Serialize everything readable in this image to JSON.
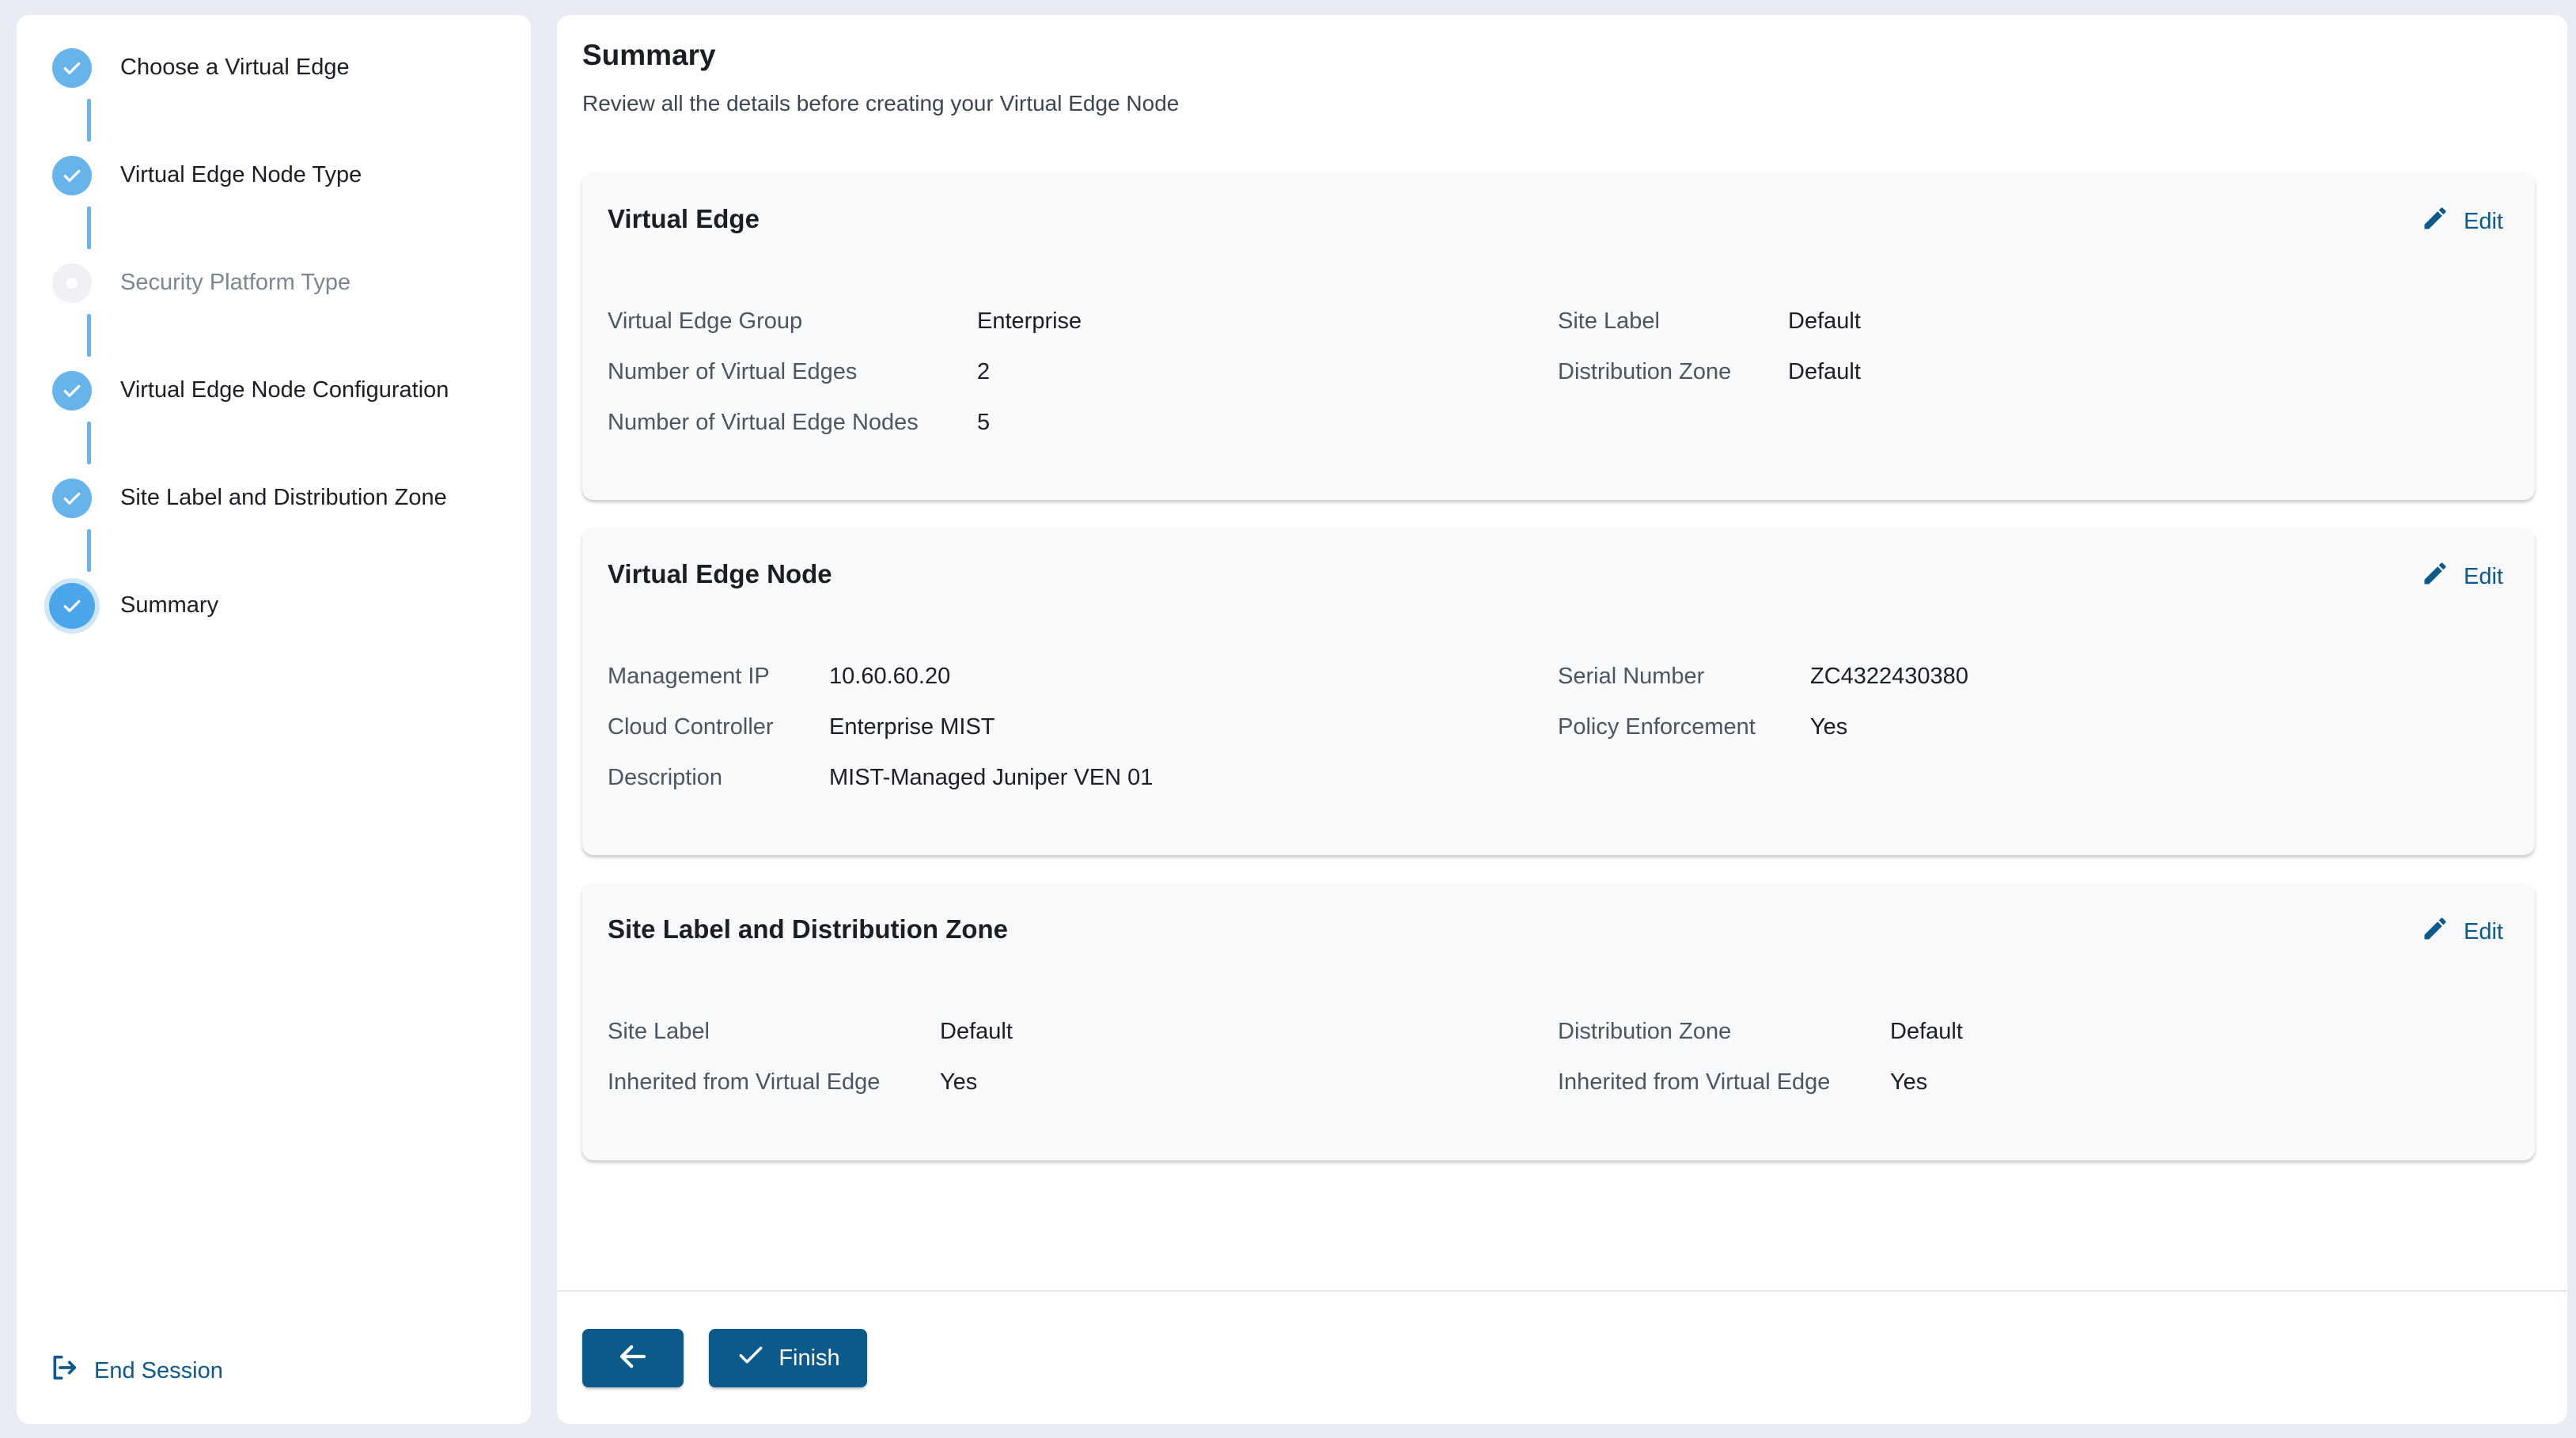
{
  "sidebar": {
    "steps": [
      {
        "label": "Choose a Virtual Edge",
        "state": "complete"
      },
      {
        "label": "Virtual Edge Node Type",
        "state": "complete"
      },
      {
        "label": "Security Platform Type",
        "state": "inactive"
      },
      {
        "label": "Virtual Edge Node Configuration",
        "state": "complete"
      },
      {
        "label": "Site Label and Distribution Zone",
        "state": "complete"
      },
      {
        "label": "Summary",
        "state": "active"
      }
    ],
    "end_session_label": "End Session"
  },
  "main": {
    "title": "Summary",
    "subtitle": "Review all the details before creating your Virtual Edge Node",
    "edit_label": "Edit",
    "cards": {
      "virtual_edge": {
        "title": "Virtual Edge",
        "left": [
          {
            "key": "Virtual Edge Group",
            "value": "Enterprise"
          },
          {
            "key": "Number of Virtual Edges",
            "value": "2"
          },
          {
            "key": "Number of Virtual Edge Nodes",
            "value": "5"
          }
        ],
        "right": [
          {
            "key": "Site Label",
            "value": "Default"
          },
          {
            "key": "Distribution Zone",
            "value": "Default"
          }
        ]
      },
      "virtual_edge_node": {
        "title": "Virtual Edge Node",
        "left": [
          {
            "key": "Management IP",
            "value": "10.60.60.20"
          },
          {
            "key": "Cloud Controller",
            "value": "Enterprise MIST"
          },
          {
            "key": "Description",
            "value": "MIST-Managed Juniper VEN 01"
          }
        ],
        "right": [
          {
            "key": "Serial Number",
            "value": "ZC4322430380"
          },
          {
            "key": "Policy Enforcement",
            "value": "Yes"
          }
        ]
      },
      "site_label": {
        "title": "Site Label and Distribution Zone",
        "left": [
          {
            "key": "Site Label",
            "value": "Default"
          },
          {
            "key": "Inherited from Virtual Edge",
            "value": "Yes"
          }
        ],
        "right": [
          {
            "key": "Distribution Zone",
            "value": "Default"
          },
          {
            "key": "Inherited from Virtual Edge",
            "value": "Yes"
          }
        ]
      }
    },
    "footer": {
      "finish_label": "Finish"
    }
  },
  "colors": {
    "accent": "#0b5a8a",
    "step_complete": "#67b3ec",
    "background": "#e9ecf3"
  },
  "icons": {
    "step_check": "check-icon",
    "edit": "pencil-icon",
    "end_session": "logout-icon",
    "back": "arrow-left-icon",
    "finish": "check-icon"
  }
}
